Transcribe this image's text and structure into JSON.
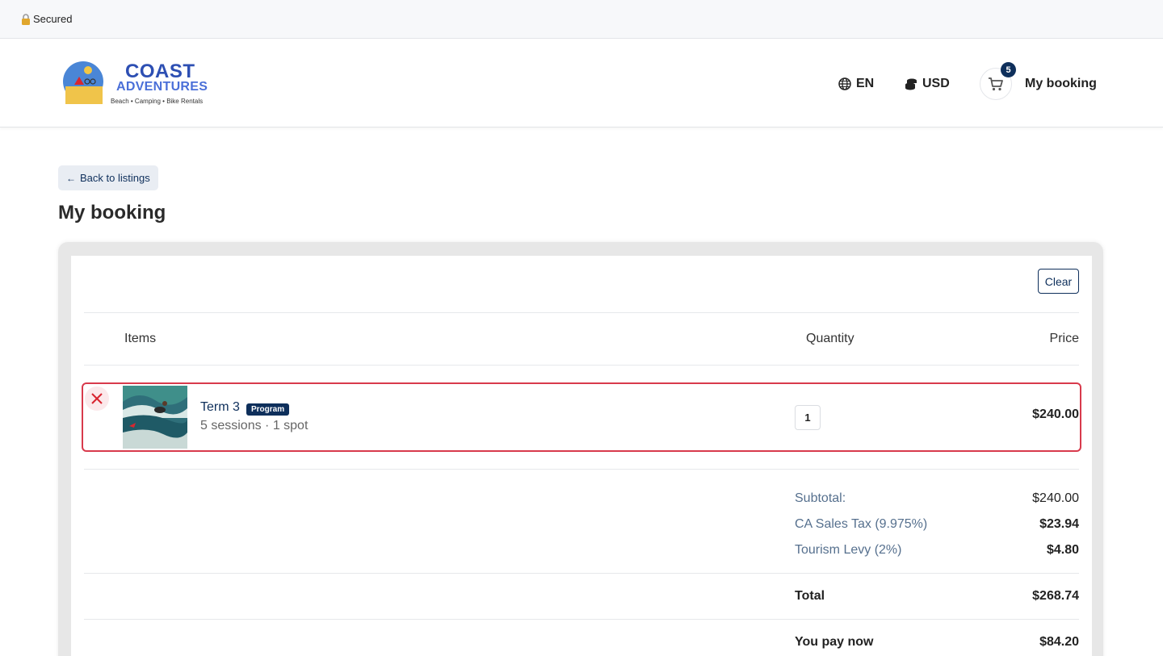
{
  "browser": {
    "secured_label": "Secured"
  },
  "header": {
    "logo": {
      "title": "COAST",
      "subtitle": "ADVENTURES",
      "tagline": "Beach • Camping • Bike Rentals"
    },
    "language": "EN",
    "currency": "USD",
    "cart_count": "5",
    "my_booking_label": "My booking"
  },
  "page": {
    "back_label": "Back to listings",
    "title": "My booking",
    "clear_label": "Clear"
  },
  "table": {
    "headers": {
      "items": "Items",
      "quantity": "Quantity",
      "price": "Price"
    },
    "items": [
      {
        "name": "Term 3",
        "tag": "Program",
        "meta": "5 sessions · 1 spot",
        "quantity": "1",
        "price": "$240.00"
      }
    ]
  },
  "summary": {
    "subtotal_label": "Subtotal:",
    "subtotal_value": "$240.00",
    "tax_label": "CA Sales Tax (9.975%)",
    "tax_value": "$23.94",
    "levy_label": "Tourism Levy (2%)",
    "levy_value": "$4.80",
    "total_label": "Total",
    "total_value": "$268.74",
    "pay_now_label": "You pay now",
    "pay_now_value": "$84.20"
  },
  "colors": {
    "brand": "#0e2f5b",
    "highlight": "#d83a4c",
    "logo_blue": "#2d4fb3"
  }
}
